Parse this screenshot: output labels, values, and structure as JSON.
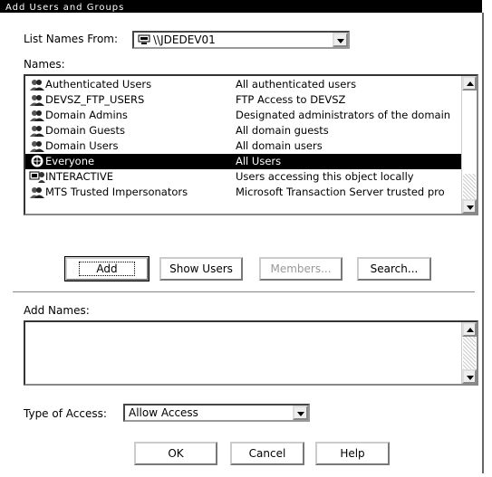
{
  "window": {
    "title": "Add Users and Groups"
  },
  "list_names_from": {
    "label": "List Names From:",
    "value": "\\\\JDEDEV01"
  },
  "names": {
    "label": "Names:",
    "items": [
      {
        "name": "Authenticated Users",
        "description": "All authenticated users",
        "icon": "group-icon"
      },
      {
        "name": "DEVSZ_FTP_USERS",
        "description": "FTP Access to DEVSZ",
        "icon": "group-icon"
      },
      {
        "name": "Domain Admins",
        "description": "Designated administrators of the domain",
        "icon": "group-icon"
      },
      {
        "name": "Domain Guests",
        "description": "All domain guests",
        "icon": "group-icon"
      },
      {
        "name": "Domain Users",
        "description": "All domain users",
        "icon": "group-icon"
      },
      {
        "name": "Everyone",
        "description": "All Users",
        "icon": "globe-icon",
        "selected": true
      },
      {
        "name": "INTERACTIVE",
        "description": "Users accessing this object locally",
        "icon": "interactive-icon"
      },
      {
        "name": "MTS Trusted Impersonators",
        "description": "Microsoft Transaction Server trusted pro",
        "icon": "group-icon"
      }
    ]
  },
  "buttons": {
    "add": "Add",
    "show_users": "Show Users",
    "members": "Members...",
    "search": "Search..."
  },
  "add_names": {
    "label": "Add Names:",
    "value": ""
  },
  "type_of_access": {
    "label": "Type of Access:",
    "value": "Allow Access"
  },
  "dialog_buttons": {
    "ok": "OK",
    "cancel": "Cancel",
    "help": "Help"
  }
}
